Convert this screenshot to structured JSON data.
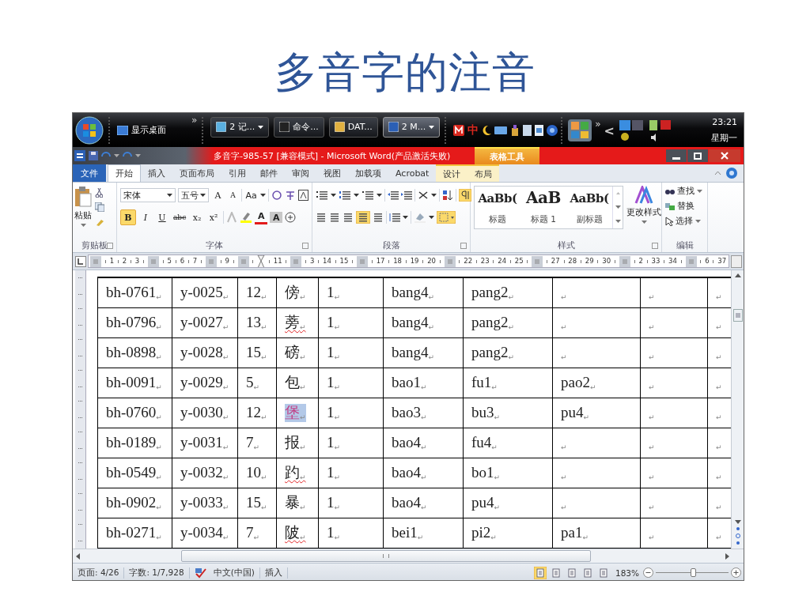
{
  "slide_title": "多音字的注音",
  "taskbar": {
    "show_desktop": "显示桌面",
    "overflow": "»",
    "tasks": [
      {
        "label": "2 记...",
        "grouped": true,
        "selected": false
      },
      {
        "label": "命令...",
        "grouped": false,
        "selected": false
      },
      {
        "label": "DAT...",
        "grouped": false,
        "selected": false
      },
      {
        "label": "2 M...",
        "grouped": true,
        "selected": true
      }
    ],
    "ime": "中",
    "tray_overflow": "»",
    "tray_expand": "<",
    "time": "23:21",
    "day": "星期一"
  },
  "title_bar": {
    "title": "多音字-985-57 [兼容模式] - Microsoft Word(产品激活失败)",
    "context_tab": "表格工具"
  },
  "ribbon_tabs": [
    {
      "label": "文件",
      "kind": "file",
      "selected": false
    },
    {
      "label": "开始",
      "kind": "normal",
      "selected": true
    },
    {
      "label": "插入",
      "kind": "normal",
      "selected": false
    },
    {
      "label": "页面布局",
      "kind": "normal",
      "selected": false
    },
    {
      "label": "引用",
      "kind": "normal",
      "selected": false
    },
    {
      "label": "邮件",
      "kind": "normal",
      "selected": false
    },
    {
      "label": "审阅",
      "kind": "normal",
      "selected": false
    },
    {
      "label": "视图",
      "kind": "normal",
      "selected": false
    },
    {
      "label": "加载项",
      "kind": "normal",
      "selected": false
    },
    {
      "label": "Acrobat",
      "kind": "normal",
      "selected": false
    },
    {
      "label": "设计",
      "kind": "context",
      "selected": false
    },
    {
      "label": "布局",
      "kind": "context",
      "selected": false
    }
  ],
  "clipboard": {
    "paste": "粘贴",
    "label": "剪贴板"
  },
  "font": {
    "name": "宋体",
    "size": "五号",
    "grow": "A",
    "shrink": "A",
    "case": "Aa",
    "buttons": [
      {
        "text": "B",
        "kind": "bold",
        "on": true
      },
      {
        "text": "I",
        "kind": "italic",
        "on": false
      },
      {
        "text": "U",
        "kind": "underline",
        "on": false
      },
      {
        "text": "abc",
        "kind": "strike",
        "on": false
      },
      {
        "text": "x₂",
        "kind": "sub",
        "on": false
      },
      {
        "text": "x²",
        "kind": "sup",
        "on": false
      }
    ],
    "color_letter": "A",
    "shading_letter": "A",
    "label": "字体"
  },
  "paragraph": {
    "show_marks_on": true,
    "justify_on": true,
    "borders_on": true,
    "label": "段落"
  },
  "styles": {
    "items": [
      {
        "sample": "AaBb(",
        "label": "标题"
      },
      {
        "sample": "AaB",
        "label": "标题 1"
      },
      {
        "sample": "AaBb(",
        "label": "副标题"
      }
    ],
    "change": "更改样式",
    "label": "样式"
  },
  "editing": {
    "find": "查找",
    "replace": "替换",
    "select": "选择",
    "label": "编辑"
  },
  "ruler": [
    {
      "kind": "marker"
    },
    {
      "kind": "num",
      "text": "1"
    },
    {
      "kind": "num",
      "text": "2"
    },
    {
      "kind": "num",
      "text": "3"
    },
    {
      "kind": "marker"
    },
    {
      "kind": "num",
      "text": "5"
    },
    {
      "kind": "num",
      "text": "6"
    },
    {
      "kind": "num",
      "text": "7"
    },
    {
      "kind": "marker"
    },
    {
      "kind": "num",
      "text": "9"
    },
    {
      "kind": "marker"
    },
    {
      "kind": "indent"
    },
    {
      "kind": "num",
      "text": "11"
    },
    {
      "kind": "marker"
    },
    {
      "kind": "num",
      "text": "3"
    },
    {
      "kind": "num",
      "text": "14"
    },
    {
      "kind": "num",
      "text": "15"
    },
    {
      "kind": "marker"
    },
    {
      "kind": "num",
      "text": "17"
    },
    {
      "kind": "num",
      "text": "18"
    },
    {
      "kind": "num",
      "text": "19"
    },
    {
      "kind": "num",
      "text": "20"
    },
    {
      "kind": "marker"
    },
    {
      "kind": "num",
      "text": "22"
    },
    {
      "kind": "num",
      "text": "23"
    },
    {
      "kind": "num",
      "text": "24"
    },
    {
      "kind": "num",
      "text": "25"
    },
    {
      "kind": "marker"
    },
    {
      "kind": "num",
      "text": "27"
    },
    {
      "kind": "num",
      "text": "28"
    },
    {
      "kind": "num",
      "text": "29"
    },
    {
      "kind": "num",
      "text": "30"
    },
    {
      "kind": "marker"
    },
    {
      "kind": "num",
      "text": "2"
    },
    {
      "kind": "num",
      "text": "33"
    },
    {
      "kind": "num",
      "text": "34"
    },
    {
      "kind": "marker"
    },
    {
      "kind": "num",
      "text": "6"
    },
    {
      "kind": "num",
      "text": "37"
    }
  ],
  "table": {
    "rows": [
      {
        "cells": [
          "bh-0761$_{↵}$",
          "y-0025$_{↵}$",
          "12$_{↵}$",
          "傍$_{↵}$",
          "1$_{↵}$",
          "bang4$_{↵}$",
          "pang2$_{↵}$",
          "$_{↵}$",
          "$_{↵}$",
          "$_{↵}$"
        ],
        "char_selected": false,
        "char_misspelled": false
      },
      {
        "cells": [
          "bh-0796$_{↵}$",
          "y-0027$_{↵}$",
          "13$_{↵}$",
          "蒡$_{↵}$",
          "1$_{↵}$",
          "bang4$_{↵}$",
          "pang2$_{↵}$",
          "$_{↵}$",
          "$_{↵}$",
          "$_{↵}$"
        ],
        "char_selected": false,
        "char_misspelled": true
      },
      {
        "cells": [
          "bh-0898$_{↵}$",
          "y-0028$_{↵}$",
          "15$_{↵}$",
          "磅$_{↵}$",
          "1$_{↵}$",
          "bang4$_{↵}$",
          "pang2$_{↵}$",
          "$_{↵}$",
          "$_{↵}$",
          "$_{↵}$"
        ],
        "char_selected": false,
        "char_misspelled": false
      },
      {
        "cells": [
          "bh-0091$_{↵}$",
          "y-0029$_{↵}$",
          "5$_{↵}$",
          "包$_{↵}$",
          "1$_{↵}$",
          "bao1$_{↵}$",
          "fu1$_{↵}$",
          "pao2$_{↵}$",
          "$_{↵}$",
          "$_{↵}$"
        ],
        "char_selected": false,
        "char_misspelled": false
      },
      {
        "cells": [
          "bh-0760$_{↵}$",
          "y-0030$_{↵}$",
          "12$_{↵}$",
          "堡$_{↵}$",
          "1$_{↵}$",
          "bao3$_{↵}$",
          "bu3$_{↵}$",
          "pu4$_{↵}$",
          "$_{↵}$",
          "$_{↵}$"
        ],
        "char_selected": true,
        "char_misspelled": false
      },
      {
        "cells": [
          "bh-0189$_{↵}$",
          "y-0031$_{↵}$",
          "7$_{↵}$",
          "报$_{↵}$",
          "1$_{↵}$",
          "bao4$_{↵}$",
          "fu4$_{↵}$",
          "$_{↵}$",
          "$_{↵}$",
          "$_{↵}$"
        ],
        "char_selected": false,
        "char_misspelled": false
      },
      {
        "cells": [
          "bh-0549$_{↵}$",
          "y-0032$_{↵}$",
          "10$_{↵}$",
          "趵$_{↵}$",
          "1$_{↵}$",
          "bao4$_{↵}$",
          "bo1$_{↵}$",
          "$_{↵}$",
          "$_{↵}$",
          "$_{↵}$"
        ],
        "char_selected": false,
        "char_misspelled": true
      },
      {
        "cells": [
          "bh-0902$_{↵}$",
          "y-0033$_{↵}$",
          "15$_{↵}$",
          "暴$_{↵}$",
          "1$_{↵}$",
          "bao4$_{↵}$",
          "pu4$_{↵}$",
          "$_{↵}$",
          "$_{↵}$",
          "$_{↵}$"
        ],
        "char_selected": false,
        "char_misspelled": false
      },
      {
        "cells": [
          "bh-0271$_{↵}$",
          "y-0034$_{↵}$",
          "7$_{↵}$",
          "陂$_{↵}$",
          "1$_{↵}$",
          "bei1$_{↵}$",
          "pi2$_{↵}$",
          "pa1$_{↵}$",
          "$_{↵}$",
          "$_{↵}$"
        ],
        "char_selected": false,
        "char_misspelled": true
      }
    ]
  },
  "status_bar": {
    "page": "页面: 4/26",
    "words": "字数: 1/7,928",
    "language": "中文(中国)",
    "mode": "插入",
    "views": [
      {
        "selected": true
      },
      {
        "selected": false
      },
      {
        "selected": false
      },
      {
        "selected": false
      },
      {
        "selected": false
      }
    ],
    "zoom": "183%",
    "zoom_slider": {
      "level": 0.52
    }
  }
}
